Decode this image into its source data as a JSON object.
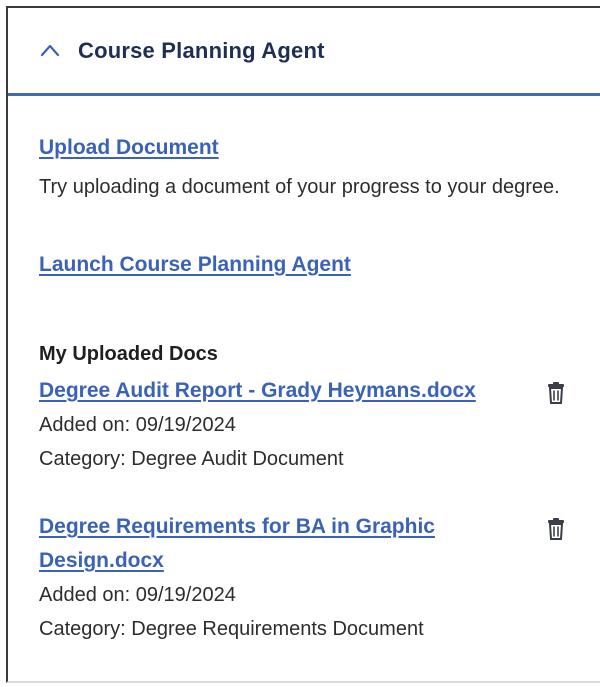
{
  "header": {
    "title": "Course Planning Agent",
    "chevron_icon": "chevron-up-icon"
  },
  "upload": {
    "link_label": "Upload Document",
    "description": "Try uploading a document of your progress to your degree."
  },
  "launch": {
    "link_label": "Launch Course Planning Agent"
  },
  "docs_section": {
    "title": "My Uploaded Docs",
    "delete_icon": "trash-icon",
    "items": [
      {
        "name": "Degree Audit Report - Grady Heymans.docx",
        "added": "Added on: 09/19/2024",
        "category": "Category: Degree Audit Document"
      },
      {
        "name": "Degree Requirements for BA in Graphic Design.docx",
        "added": "Added on: 09/19/2024",
        "category": "Category: Degree Requirements Document"
      }
    ]
  },
  "colors": {
    "link": "#3a63b8",
    "header_title": "#1e2f52",
    "divider": "#3f6bb3",
    "text": "#2d2d2d"
  }
}
